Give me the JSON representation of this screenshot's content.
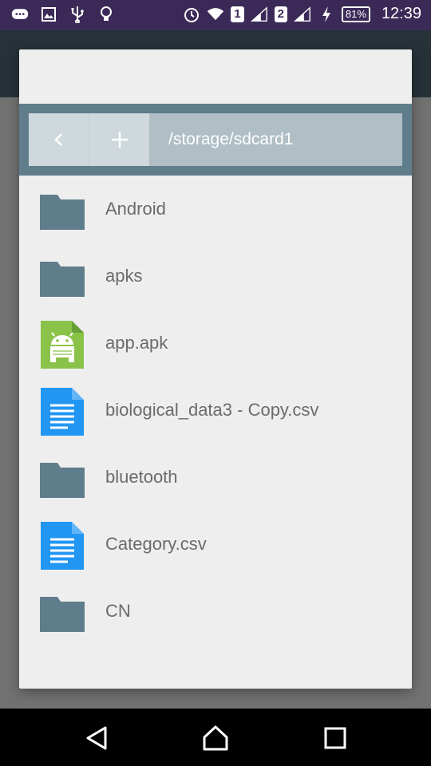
{
  "status_bar": {
    "time": "12:39",
    "battery": "81%",
    "sim1": "1",
    "sim2": "2",
    "icons_left": [
      "messages-icon",
      "gallery-icon",
      "usb-icon",
      "bulb-icon"
    ],
    "icons_right": [
      "alarm-icon",
      "wifi-icon",
      "signal-icon",
      "charging-icon"
    ]
  },
  "dialog": {
    "path": "/storage/sdcard1",
    "back_icon": "chevron-left-icon",
    "add_icon": "plus-icon",
    "items": [
      {
        "name": "Android",
        "type": "folder"
      },
      {
        "name": "apks",
        "type": "folder"
      },
      {
        "name": "app.apk",
        "type": "apk"
      },
      {
        "name": "biological_data3 - Copy.csv",
        "type": "document"
      },
      {
        "name": "bluetooth",
        "type": "folder"
      },
      {
        "name": "Category.csv",
        "type": "document"
      },
      {
        "name": "CN",
        "type": "folder"
      }
    ]
  },
  "colors": {
    "status_bar": "#3b2a57",
    "path_bar": "#607d8b",
    "folder": "#607d8b",
    "apk": "#8bc34a",
    "document": "#2196f3"
  },
  "nav_bar": {
    "buttons": [
      "back-icon",
      "home-icon",
      "recents-icon"
    ]
  }
}
